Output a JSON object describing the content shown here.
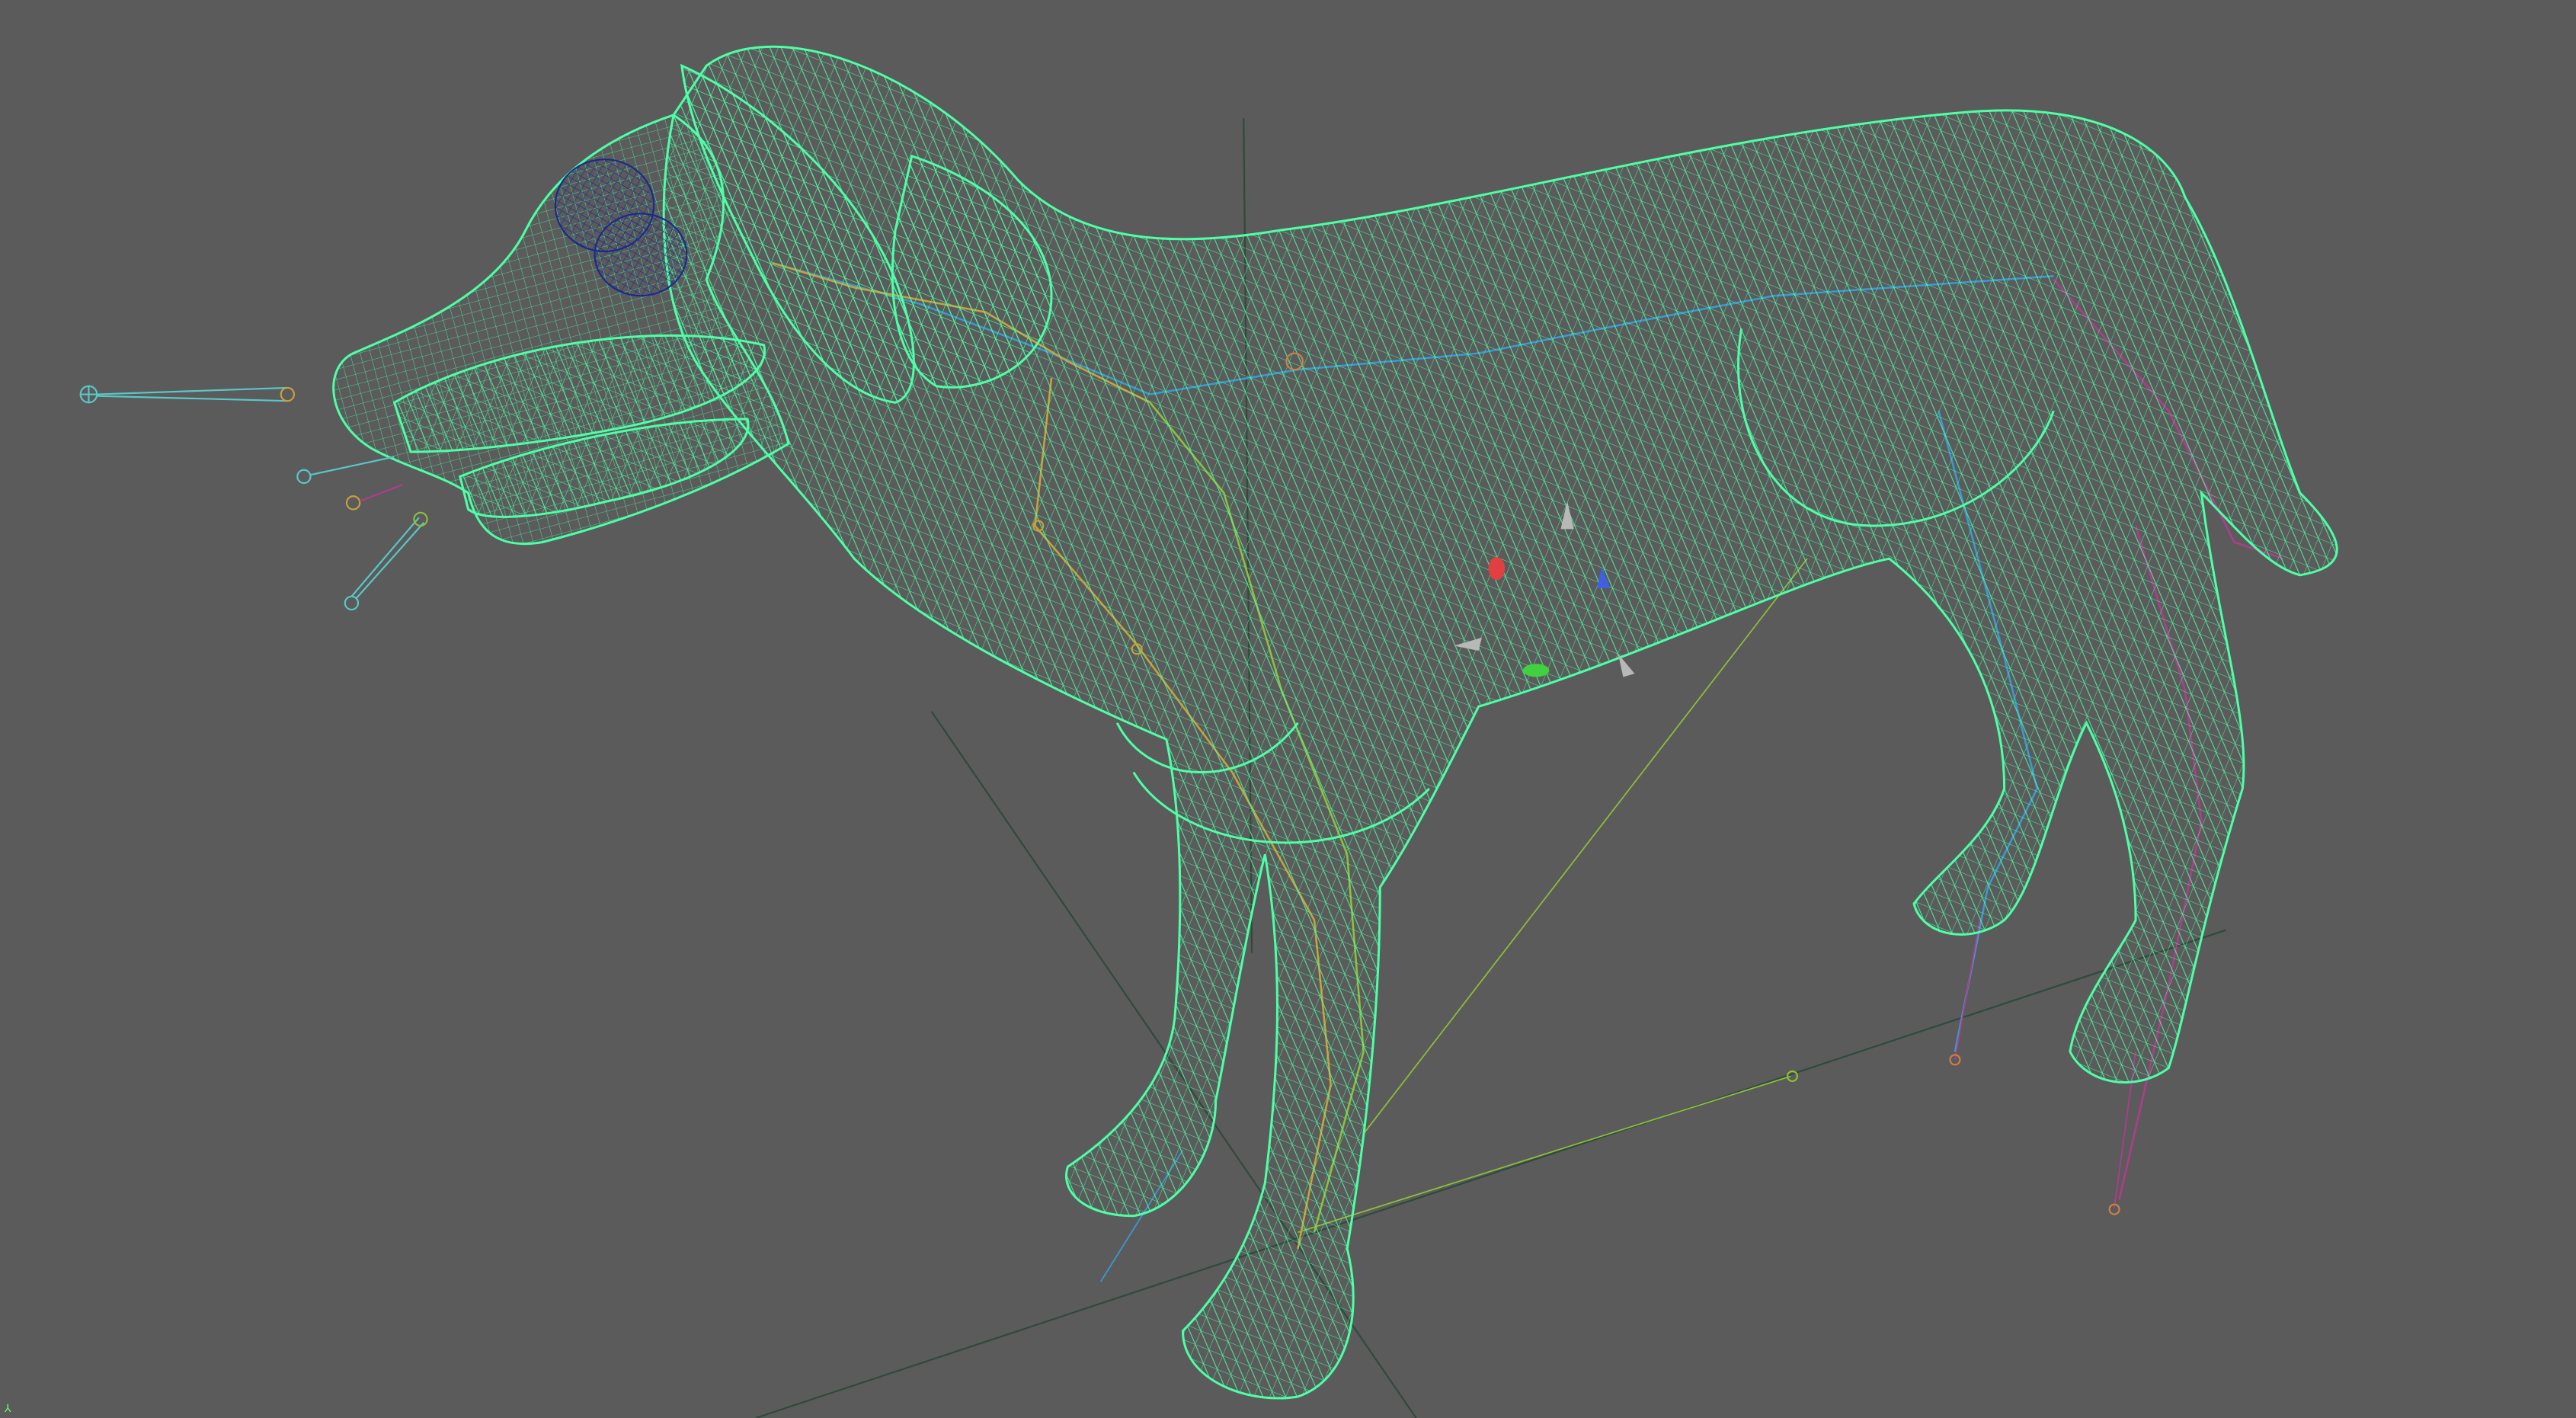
{
  "viewport": {
    "name": "3d-viewport",
    "display_mode": "wireframe",
    "background_color": "#5b5b5b"
  },
  "model": {
    "subject": "dog-mesh",
    "mesh_color": "#4dffa6",
    "eye_color": "#1a2a8c"
  },
  "rig": {
    "bone_colors": [
      "#c8a23a",
      "#3a9ad0",
      "#b03c8c",
      "#8fbf3a",
      "#5ac8c8"
    ],
    "locators": [
      "nose-locator",
      "jaw-locator-upper",
      "jaw-locator-lower",
      "jaw-locator-tip",
      "rear-leg-locator",
      "rear-foot-locator",
      "ground-locator"
    ]
  },
  "manipulator": {
    "x_axis_color": "#e04040",
    "y_axis_color": "#40d040",
    "z_axis_color": "#4060e0"
  },
  "ground_grid": {
    "color": "#2f4a3a"
  }
}
